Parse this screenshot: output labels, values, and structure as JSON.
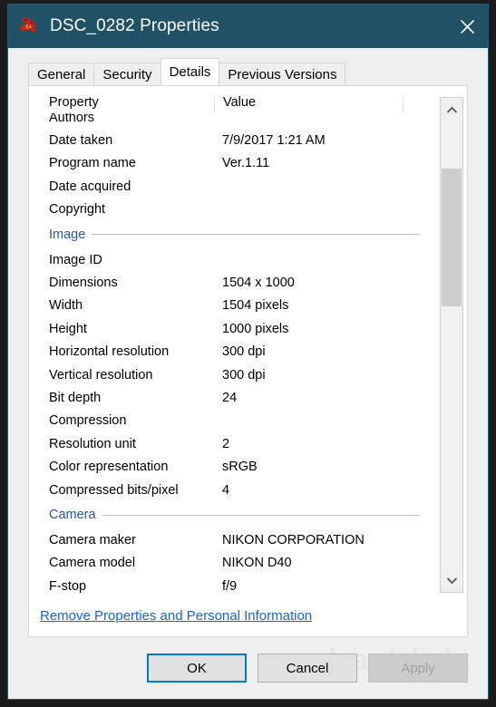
{
  "window": {
    "title": "DSC_0282 Properties",
    "icon": "app-icon",
    "close_label": "✕",
    "titlebar_color": "#215166"
  },
  "tabs": [
    {
      "label": "General",
      "active": false
    },
    {
      "label": "Security",
      "active": false
    },
    {
      "label": "Details",
      "active": true
    },
    {
      "label": "Previous Versions",
      "active": false
    }
  ],
  "list": {
    "headers": {
      "property": "Property",
      "value": "Value"
    },
    "rows": [
      {
        "type": "item",
        "property": "Authors",
        "value": ""
      },
      {
        "type": "item",
        "property": "Date taken",
        "value": "7/9/2017 1:21 AM"
      },
      {
        "type": "item",
        "property": "Program name",
        "value": "Ver.1.11"
      },
      {
        "type": "item",
        "property": "Date acquired",
        "value": ""
      },
      {
        "type": "item",
        "property": "Copyright",
        "value": ""
      },
      {
        "type": "group",
        "property": "Image",
        "value": ""
      },
      {
        "type": "item",
        "property": "Image ID",
        "value": ""
      },
      {
        "type": "item",
        "property": "Dimensions",
        "value": "1504 x 1000"
      },
      {
        "type": "item",
        "property": "Width",
        "value": "1504 pixels"
      },
      {
        "type": "item",
        "property": "Height",
        "value": "1000 pixels"
      },
      {
        "type": "item",
        "property": "Horizontal resolution",
        "value": "300 dpi"
      },
      {
        "type": "item",
        "property": "Vertical resolution",
        "value": "300 dpi"
      },
      {
        "type": "item",
        "property": "Bit depth",
        "value": "24"
      },
      {
        "type": "item",
        "property": "Compression",
        "value": ""
      },
      {
        "type": "item",
        "property": "Resolution unit",
        "value": "2"
      },
      {
        "type": "item",
        "property": "Color representation",
        "value": "sRGB"
      },
      {
        "type": "item",
        "property": "Compressed bits/pixel",
        "value": "4"
      },
      {
        "type": "group",
        "property": "Camera",
        "value": ""
      },
      {
        "type": "item",
        "property": "Camera maker",
        "value": "NIKON CORPORATION"
      },
      {
        "type": "item",
        "property": "Camera model",
        "value": "NIKON D40"
      },
      {
        "type": "item",
        "property": "F-stop",
        "value": "f/9"
      }
    ],
    "scrollbar": {
      "up_arrow": "chevron-up",
      "down_arrow": "chevron-down"
    }
  },
  "link": {
    "label": "Remove Properties and Personal Information",
    "color": "#1763d6"
  },
  "buttons": {
    "ok": "OK",
    "cancel": "Cancel",
    "apply": "Apply",
    "apply_disabled": true,
    "focus_color": "#0078d7"
  },
  "watermark": {
    "text": "cleardelight"
  }
}
